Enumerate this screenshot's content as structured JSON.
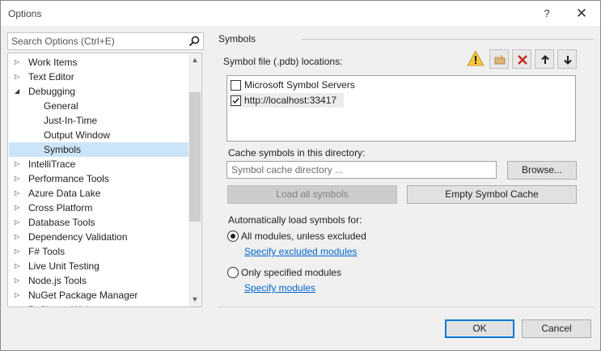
{
  "window": {
    "title": "Options",
    "help_label": "?",
    "close_label": "✕"
  },
  "search": {
    "placeholder": "Search Options (Ctrl+E)"
  },
  "tree": {
    "items": [
      {
        "label": "Work Items",
        "arrow": "▷"
      },
      {
        "label": "Text Editor",
        "arrow": "▷"
      },
      {
        "label": "Debugging",
        "arrow": "◢"
      },
      {
        "label": "General",
        "arrow": ""
      },
      {
        "label": "Just-In-Time",
        "arrow": ""
      },
      {
        "label": "Output Window",
        "arrow": ""
      },
      {
        "label": "Symbols",
        "arrow": "",
        "selected": true
      },
      {
        "label": "IntelliTrace",
        "arrow": "▷"
      },
      {
        "label": "Performance Tools",
        "arrow": "▷"
      },
      {
        "label": "Azure Data Lake",
        "arrow": "▷"
      },
      {
        "label": "Cross Platform",
        "arrow": "▷"
      },
      {
        "label": "Database Tools",
        "arrow": "▷"
      },
      {
        "label": "Dependency Validation",
        "arrow": "▷"
      },
      {
        "label": "F# Tools",
        "arrow": "▷"
      },
      {
        "label": "Live Unit Testing",
        "arrow": "▷"
      },
      {
        "label": "Node.js Tools",
        "arrow": "▷"
      },
      {
        "label": "NuGet Package Manager",
        "arrow": "▷"
      },
      {
        "label": "PyCharm Web",
        "arrow": "▷"
      }
    ]
  },
  "panel": {
    "section_title": "Symbols",
    "locations_label": "Symbol file (.pdb) locations:",
    "locations": [
      {
        "label": "Microsoft Symbol Servers",
        "checked": false
      },
      {
        "label": "http://localhost:33417",
        "checked": true
      }
    ],
    "cache_label": "Cache symbols in this directory:",
    "cache_placeholder": "Symbol cache directory ...",
    "browse_label": "Browse...",
    "load_all_label": "Load all symbols",
    "empty_cache_label": "Empty Symbol Cache",
    "auto_label": "Automatically load symbols for:",
    "option_all": "All modules, unless excluded",
    "link_excluded": "Specify excluded modules",
    "option_specified": "Only specified modules",
    "link_modules": "Specify modules"
  },
  "footer": {
    "ok_label": "OK",
    "cancel_label": "Cancel"
  },
  "colors": {
    "accent": "#0078d7",
    "link": "#0066cc",
    "selection": "#cce4f7",
    "delete_red": "#c42b1c",
    "warning": "#ffc83d"
  }
}
